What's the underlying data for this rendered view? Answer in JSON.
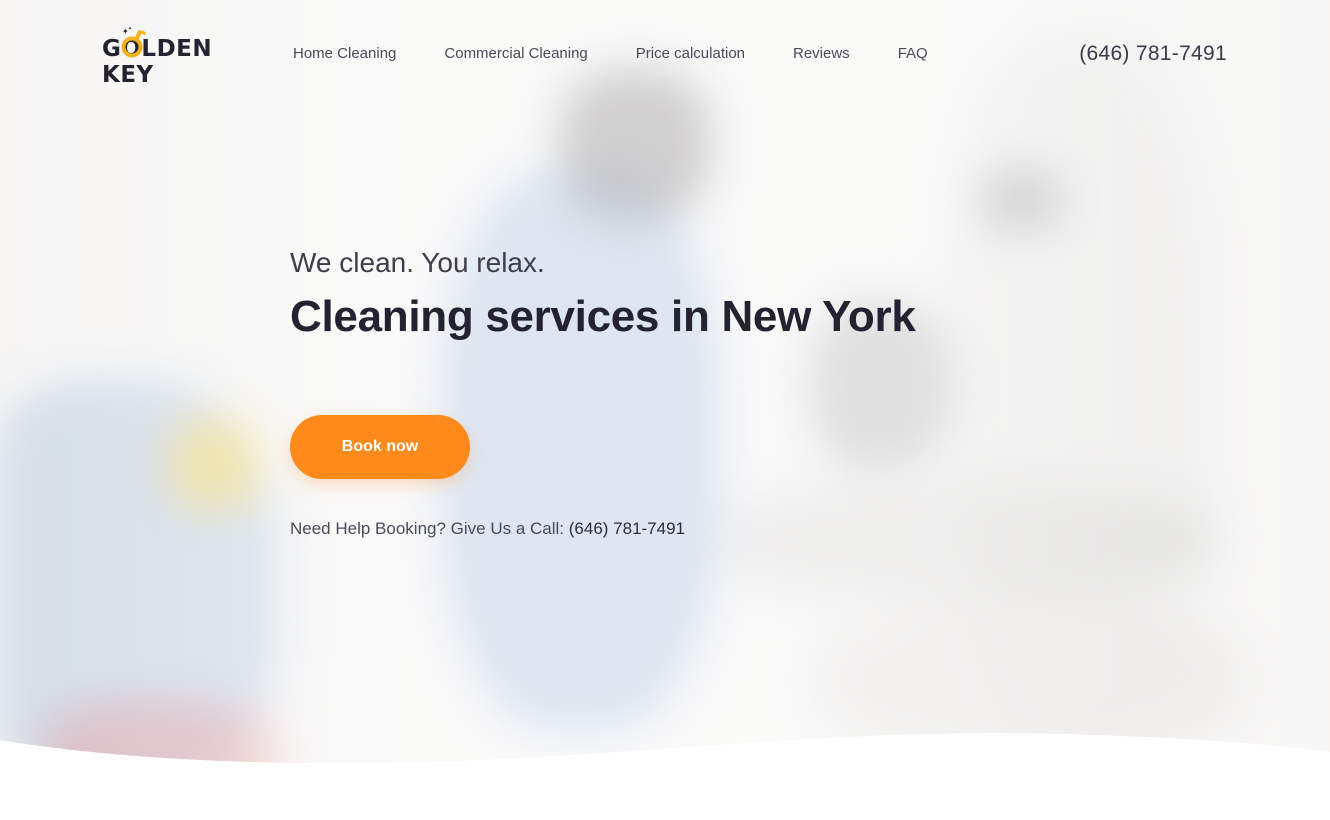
{
  "brand": {
    "logo_line1": "GOLDEN",
    "logo_line2": "KEY",
    "accent_color": "#ff8a1c",
    "logo_key_color": "#f6b21b"
  },
  "nav": {
    "items": [
      {
        "label": "Home Cleaning"
      },
      {
        "label": "Commercial Cleaning"
      },
      {
        "label": "Price calculation"
      },
      {
        "label": "Reviews"
      },
      {
        "label": "FAQ"
      }
    ]
  },
  "header": {
    "phone": "(646) 781-7491"
  },
  "hero": {
    "tagline": "We clean. You relax.",
    "headline": "Cleaning services in New York",
    "cta_label": "Book now",
    "help_text": "Need Help Booking? Give Us a Call: ",
    "help_phone": "(646) 781-7491"
  }
}
